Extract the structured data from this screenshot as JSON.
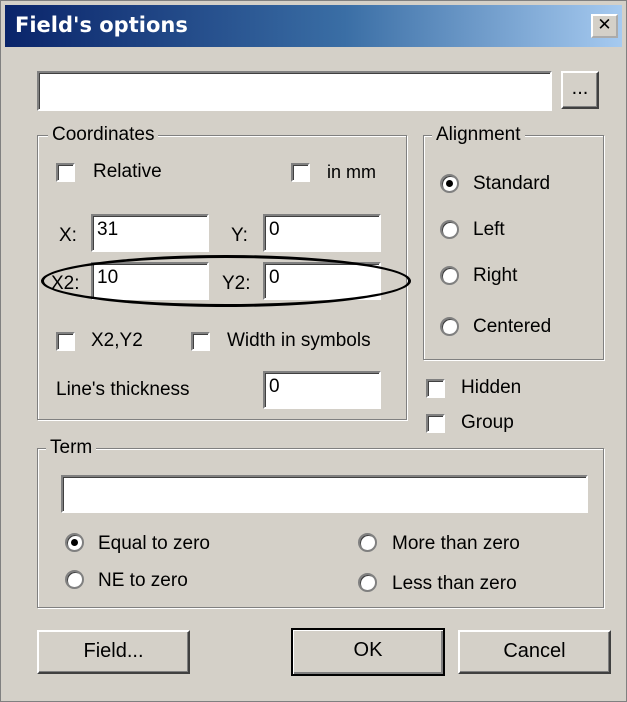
{
  "window": {
    "title": "Field's options",
    "close_glyph": "✕"
  },
  "field_text": {
    "value": "",
    "browse_label": "..."
  },
  "coordinates": {
    "legend": "Coordinates",
    "relative_label": "Relative",
    "in_mm_label": "in mm",
    "x_label": "X:",
    "x_value": "31",
    "y_label": "Y:",
    "y_value": "0",
    "x2_label": "X2:",
    "x2_value": "10",
    "y2_label": "Y2:",
    "y2_value": "0",
    "x2y2_label": "X2,Y2",
    "width_in_symbols_label": "Width in symbols",
    "thickness_label": "Line's thickness",
    "thickness_value": "0"
  },
  "alignment": {
    "legend": "Alignment",
    "options": [
      "Standard",
      "Left",
      "Right",
      "Centered"
    ],
    "selected": "Standard"
  },
  "hidden_label": "Hidden",
  "group_label": "Group",
  "term": {
    "legend": "Term",
    "value": "",
    "options": [
      "Equal to zero",
      "More than zero",
      "NE to zero",
      "Less than zero"
    ],
    "selected": "Equal to zero"
  },
  "buttons": {
    "field": "Field...",
    "ok": "OK",
    "cancel": "Cancel"
  }
}
